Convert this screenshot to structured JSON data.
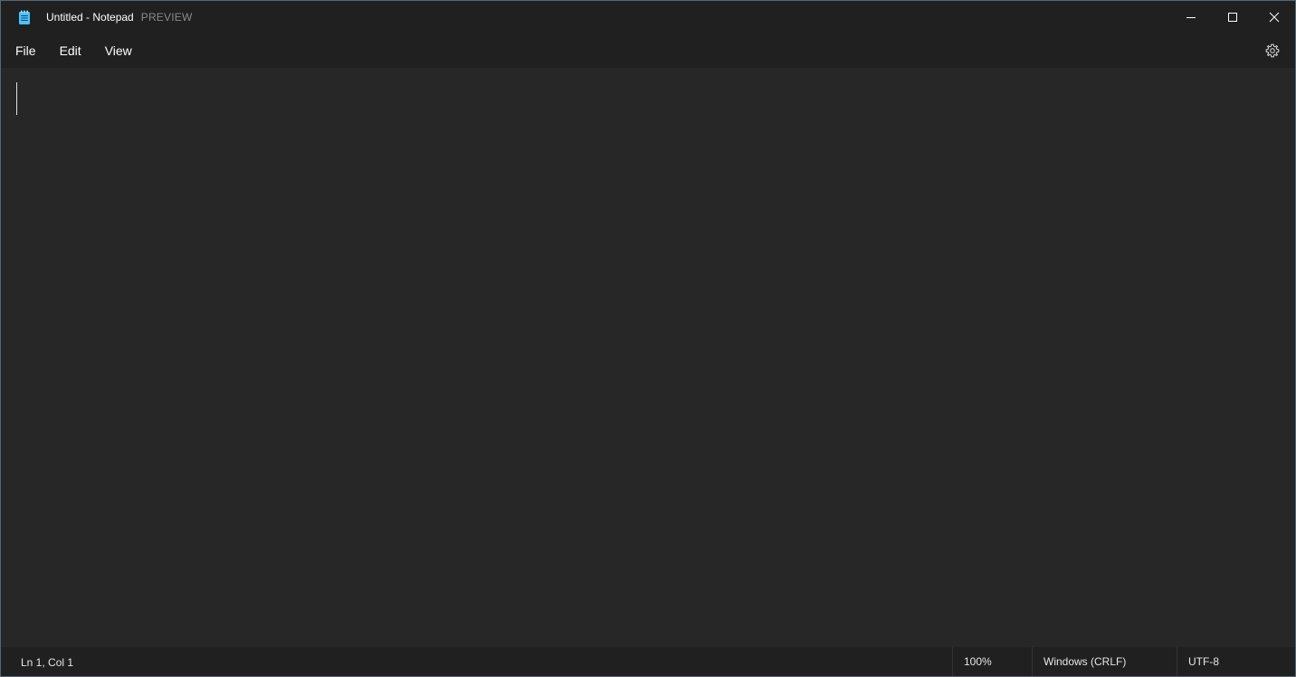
{
  "window": {
    "title": "Untitled - Notepad",
    "preview_tag": "PREVIEW",
    "app_icon": "notepad-icon",
    "caption_buttons": {
      "minimize_icon": "minimize-icon",
      "maximize_icon": "maximize-icon",
      "close_icon": "close-icon"
    }
  },
  "menu": {
    "items": [
      "File",
      "Edit",
      "View"
    ],
    "settings_icon": "gear-icon"
  },
  "editor": {
    "content": ""
  },
  "status": {
    "position": "Ln 1, Col 1",
    "zoom": "100%",
    "line_ending": "Windows (CRLF)",
    "encoding": "UTF-8"
  },
  "colors": {
    "titlebar_bg": "#202020",
    "editor_bg": "#272727",
    "accent_icon": "#4cc2ff"
  }
}
